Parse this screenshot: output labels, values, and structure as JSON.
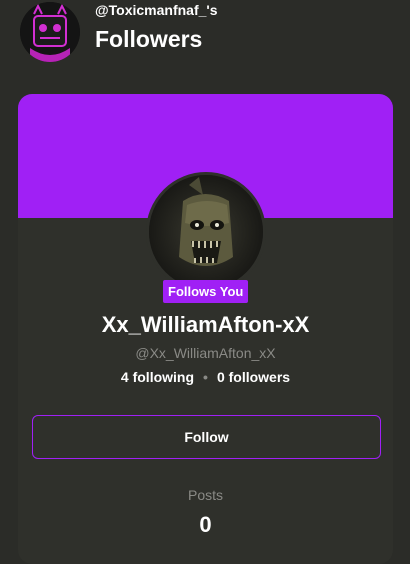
{
  "header": {
    "owner_handle": "@Toxicmanfnaf_'s",
    "title": "Followers",
    "owner_avatar_icon": "profile-avatar-icon"
  },
  "profile": {
    "avatar_icon": "animatronic-avatar-icon",
    "badge": "Follows You",
    "display_name": "Xx_WilliamAfton-xX",
    "username": "@Xx_WilliamAfton_xX",
    "following": "4 following",
    "separator": "•",
    "followers": "0 followers",
    "follow_button": "Follow",
    "posts_label": "Posts",
    "posts_count": "0"
  },
  "colors": {
    "accent": "#a020f5",
    "background": "#2b2c28",
    "card": "#2f302b",
    "muted_text": "#8a8a86"
  }
}
